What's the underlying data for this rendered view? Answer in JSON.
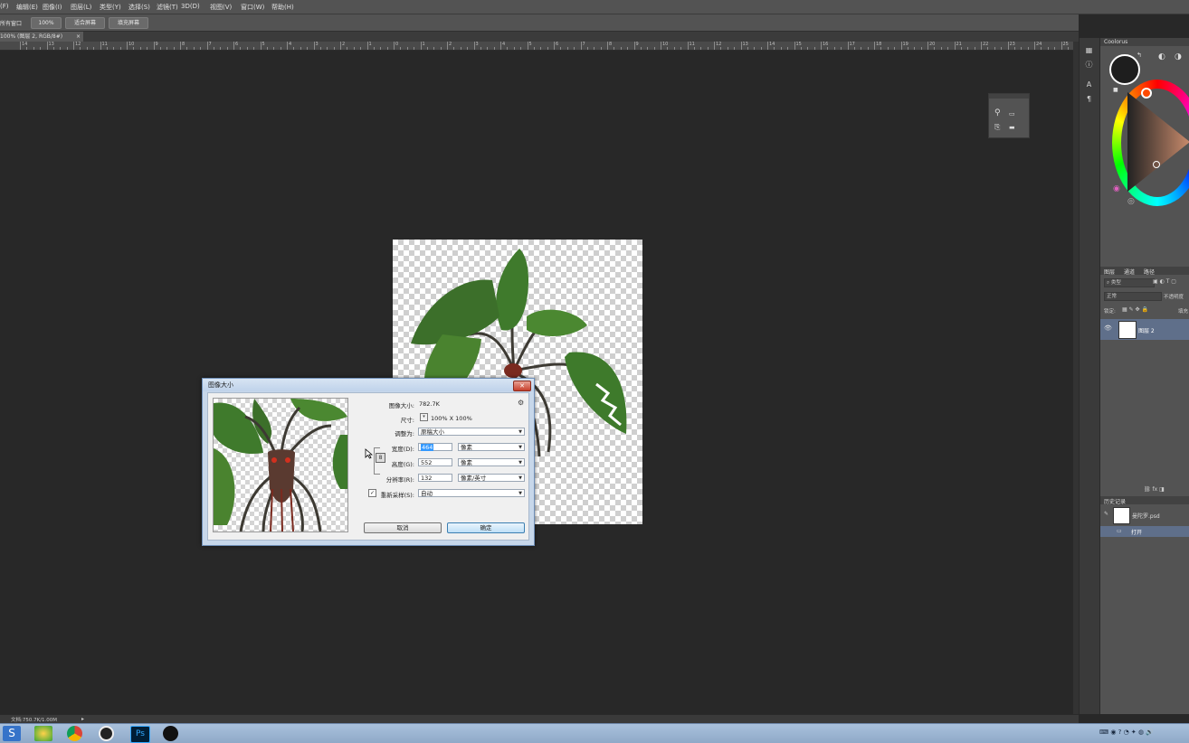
{
  "menu": [
    "(F)",
    "编辑(E)",
    "图像(I)",
    "图层(L)",
    "类型(Y)",
    "选择(S)",
    "滤镜(T)",
    "3D(D)",
    "视图(V)",
    "窗口(W)",
    "帮助(H)"
  ],
  "options": {
    "window_label": "所有窗口",
    "zoom_btn": "100%",
    "fit_screen_btn": "适合屏幕",
    "fill_screen_btn": "填充屏幕"
  },
  "document_tab": {
    "label": "100% (图层 2, RGB/8#)",
    "close": "×"
  },
  "ruler_labels": [
    "14",
    "13",
    "12",
    "11",
    "10",
    "9",
    "8",
    "7",
    "6",
    "5",
    "4",
    "3",
    "2",
    "1",
    "0",
    "1",
    "2",
    "3",
    "4",
    "5",
    "6",
    "7",
    "8",
    "9",
    "10",
    "11",
    "12",
    "13",
    "14",
    "15",
    "16",
    "17",
    "18",
    "19",
    "20",
    "21",
    "22",
    "23",
    "24",
    "25"
  ],
  "dialog": {
    "title": "图像大小",
    "close": "✕",
    "image_size_label": "图像大小:",
    "image_size_value": "782.7K",
    "dimensions_label": "尺寸:",
    "dimensions_value": "100%  X  100%",
    "fit_to_label": "调整为:",
    "fit_to_value": "原稿大小",
    "width_label": "宽度(D):",
    "width_value": "464",
    "width_unit": "像素",
    "height_label": "高度(G):",
    "height_value": "552",
    "height_unit": "像素",
    "resolution_label": "分辨率(R):",
    "resolution_value": "132",
    "resolution_unit": "像素/英寸",
    "resample_label": "重新采样(S):",
    "resample_value": "自动",
    "resample_checked": true,
    "cancel_label": "取消",
    "ok_label": "确定"
  },
  "right_panel": {
    "color_tab": "Coolorus",
    "layers_tabs": [
      "图层",
      "通道",
      "路径"
    ],
    "kind_filter": "类型",
    "blend_mode": "正常",
    "opacity_label": "不透明度",
    "lock_label": "锁定:",
    "fill_label": "填充",
    "layer_name": "图层 2",
    "history_tab": "历史记录",
    "history_file": "曼陀罗.psd",
    "history_step": "打开"
  },
  "status": {
    "doc_info": "文档:750.7K/1.00M"
  },
  "accent": {
    "selection": "#3399ff",
    "ok_button_border": "#3c7fb1",
    "layer_highlight": "#5f6f8a"
  }
}
